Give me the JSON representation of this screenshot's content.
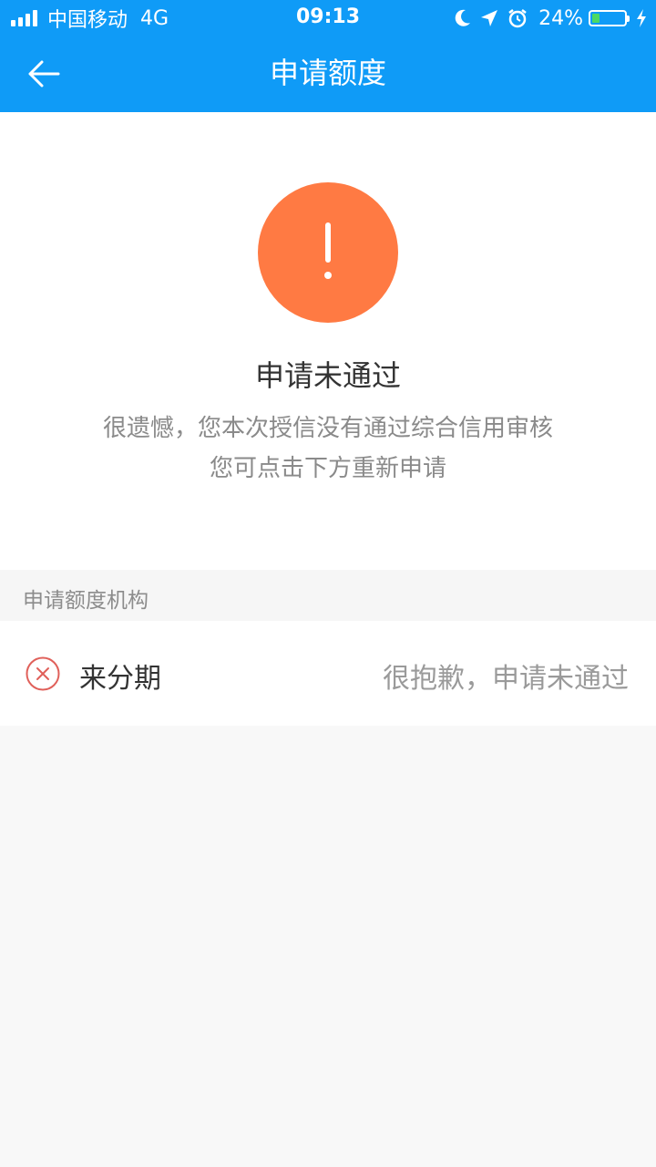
{
  "status_bar": {
    "carrier": "中国移动",
    "network": "4G",
    "time": "09:13",
    "battery_percent": "24%",
    "battery_level": 0.24,
    "icons": [
      "signal-icon",
      "moon-icon",
      "location-arrow-icon",
      "alarm-icon",
      "battery-icon",
      "charging-bolt-icon"
    ]
  },
  "nav": {
    "back_icon": "arrow-left-icon",
    "title": "申请额度"
  },
  "result": {
    "icon": "exclamation-icon",
    "icon_color": "#ff7a43",
    "title": "申请未通过",
    "desc_line1": "很遗憾，您本次授信没有通过综合信用审核",
    "desc_line2": "您可点击下方重新申请"
  },
  "institutions": {
    "header": "申请额度机构",
    "items": [
      {
        "icon": "x-circle-icon",
        "name": "来分期",
        "status": "很抱歉，申请未通过"
      }
    ]
  },
  "colors": {
    "header_bg": "#0f9bf7",
    "alert": "#ff7a43",
    "reject": "#e0605a",
    "page_bg": "#f8f8f8"
  }
}
